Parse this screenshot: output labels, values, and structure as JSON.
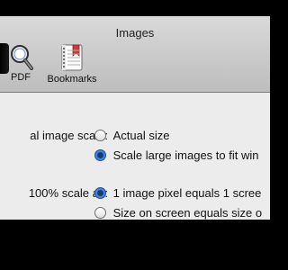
{
  "window": {
    "title": "Images"
  },
  "toolbar": {
    "items": [
      {
        "label": "PDF",
        "icon": "pdf-magnifier-icon"
      },
      {
        "label": "Bookmarks",
        "icon": "bookmarks-notebook-icon"
      }
    ]
  },
  "prefs": {
    "image_scale": {
      "label": "al image scale:",
      "options": [
        {
          "label": "Actual size",
          "selected": false
        },
        {
          "label": "Scale large images to fit win",
          "selected": true
        }
      ]
    },
    "scale_100": {
      "label": "100% scale as:",
      "options": [
        {
          "label": "1 image pixel equals 1 scree",
          "selected": true
        },
        {
          "label": "Size on screen equals size o",
          "selected": false
        }
      ]
    }
  },
  "colors": {
    "toolbar_gradient_top": "#d9d9d9",
    "toolbar_gradient_bottom": "#bdbdbd",
    "content_bg": "#ececec",
    "radio_selected": "#2f6cc8"
  }
}
